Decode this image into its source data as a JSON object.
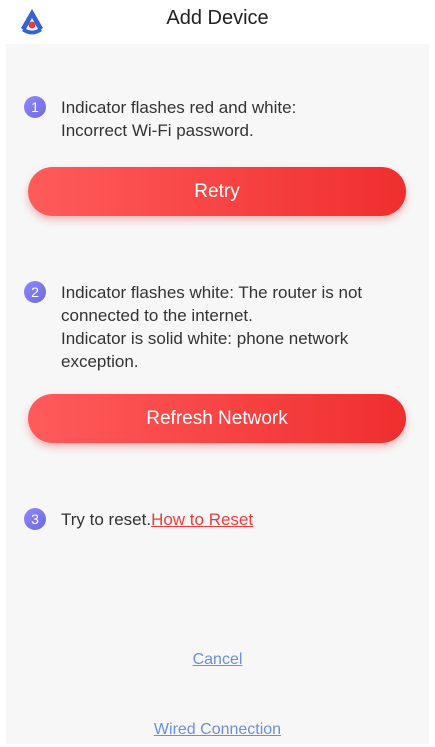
{
  "header": {
    "title": "Add Device",
    "logo_icon": "app-logo-icon"
  },
  "steps": [
    {
      "number": "1",
      "text": "Indicator flashes red and white:\nIncorrect Wi-Fi password.",
      "button_label": "Retry"
    },
    {
      "number": "2",
      "text": "Indicator flashes white: The router is not connected to the internet.\n Indicator is solid white: phone network exception.",
      "button_label": "Refresh Network"
    },
    {
      "number": "3",
      "text": "Try to reset.",
      "link_label": "How to Reset"
    }
  ],
  "footer": {
    "cancel_label": "Cancel",
    "wired_label": "Wired Connection"
  },
  "colors": {
    "accent_red": "#f02e2e",
    "badge_purple": "#7b76e6",
    "link_blue": "#6d8fd8",
    "logo_blue": "#2f63d6"
  }
}
